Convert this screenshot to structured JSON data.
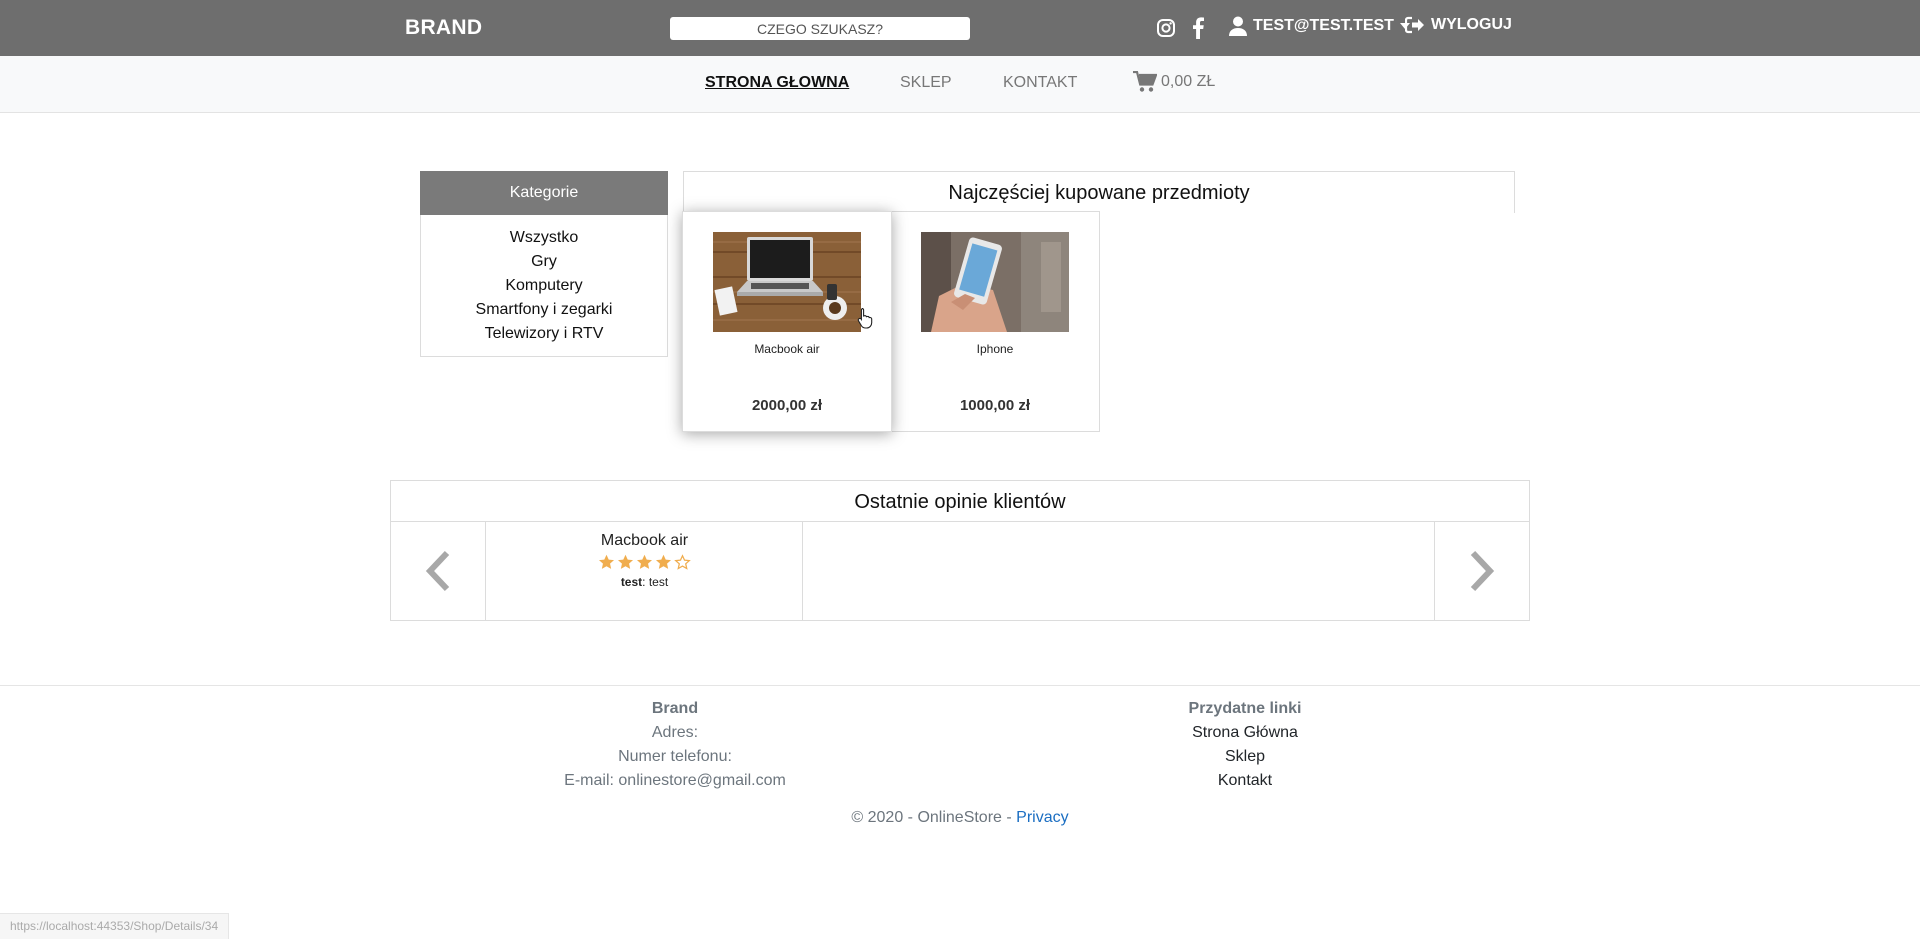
{
  "header": {
    "brand": "BRAND",
    "search_placeholder": "CZEGO SZUKASZ?",
    "user_email": "TEST@TEST.TEST",
    "logout_label": "WYLOGUJ",
    "icons": [
      "instagram-icon",
      "facebook-icon",
      "user-icon",
      "caret-down-icon",
      "sign-out-icon"
    ]
  },
  "nav": {
    "items": [
      {
        "label": "STRONA GŁOWNA",
        "active": true
      },
      {
        "label": "SKLEP",
        "active": false
      },
      {
        "label": "KONTAKT",
        "active": false
      }
    ],
    "cart_total": "0,00 ZŁ"
  },
  "categories": {
    "title": "Kategorie",
    "items": [
      "Wszystko",
      "Gry",
      "Komputery",
      "Smartfony i zegarki",
      "Telewizory i RTV"
    ]
  },
  "popular": {
    "title": "Najczęściej kupowane przedmioty",
    "products": [
      {
        "name": "Macbook air",
        "price": "2000,00 zł",
        "image": "laptop-on-desk-photo"
      },
      {
        "name": "Iphone",
        "price": "1000,00 zł",
        "image": "hand-holding-phone-photo"
      }
    ]
  },
  "reviews": {
    "title": "Ostatnie opinie klientów",
    "items": [
      {
        "product": "Macbook air",
        "rating": 4,
        "max_rating": 5,
        "author": "test",
        "text": "test"
      }
    ]
  },
  "footer": {
    "col1": {
      "title": "Brand",
      "lines": [
        "Adres:",
        "Numer telefonu:"
      ],
      "email_label": "E-mail:",
      "email": "onlinestore@gmail.com"
    },
    "col2": {
      "title": "Przydatne linki",
      "links": [
        "Strona Główna",
        "Sklep",
        "Kontakt"
      ]
    },
    "copyright": "© 2020 - OnlineStore -",
    "privacy": "Privacy"
  },
  "status_url": "https://localhost:44353/Shop/Details/34",
  "colors": {
    "topbar": "#6e6e6e",
    "star": "#f0ad4e",
    "link": "#1b6ec2"
  }
}
